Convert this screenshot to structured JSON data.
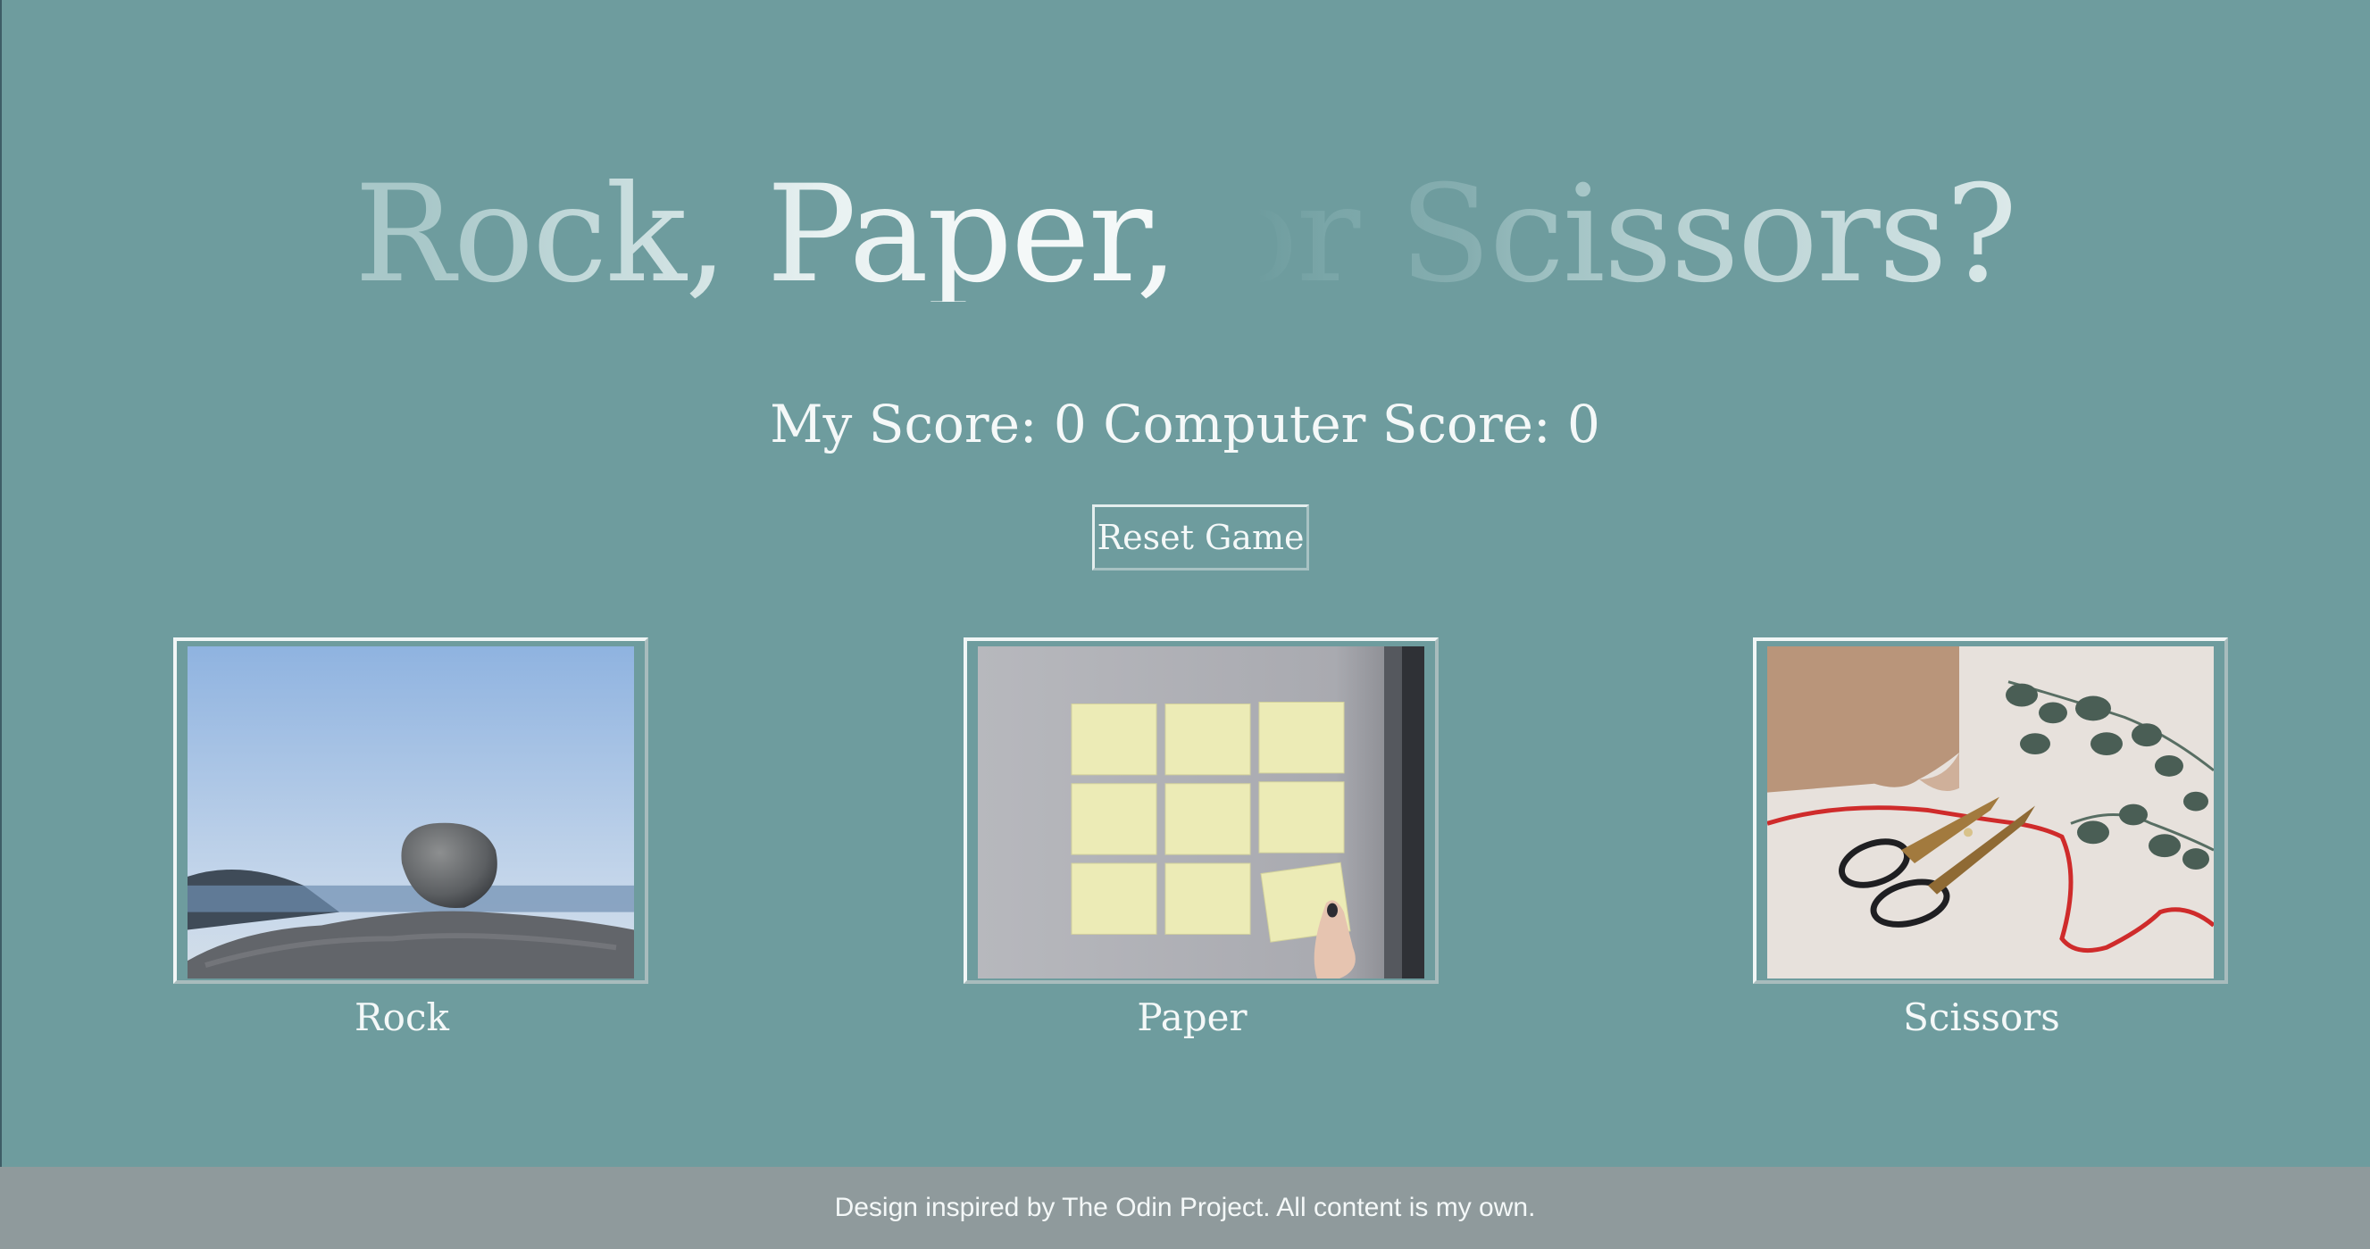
{
  "header": {
    "title": "Rock, Paper, or Scissors?"
  },
  "score": {
    "my_label": "My Score: ",
    "my_value": "0",
    "computer_label": " Computer Score: ",
    "computer_value": "0"
  },
  "controls": {
    "reset_label": "Reset Game"
  },
  "choices": [
    {
      "id": "rock",
      "label": "Rock",
      "image": "rock-photo"
    },
    {
      "id": "paper",
      "label": "Paper",
      "image": "sticky-notes-photo"
    },
    {
      "id": "scissors",
      "label": "Scissors",
      "image": "scissors-photo"
    }
  ],
  "footer": {
    "text": "Design inspired by The Odin Project. All content is my own."
  },
  "colors": {
    "background": "#6e9c9e",
    "footer": "#8f9a9c",
    "text": "#f4f8f8"
  }
}
